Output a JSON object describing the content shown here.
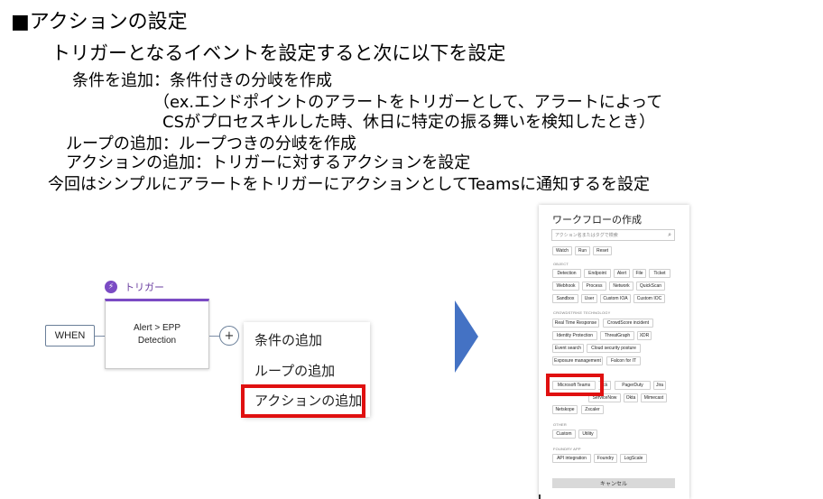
{
  "slide": {
    "title": "■アクションの設定",
    "line1": "トリガーとなるイベントを設定すると次に以下を設定",
    "line2": "条件を追加：条件付きの分岐を作成",
    "line3": "（ex.エンドポイントのアラートをトリガーとして、アラートによって",
    "line4": "CSがプロセスキルした時、休日に特定の振る舞いを検知したとき）",
    "line5": "ループの追加：ループつきの分岐を作成",
    "line6": "アクションの追加：トリガーに対するアクションを設定",
    "line7": "今回はシンプルにアラートをトリガーにアクションとしてTeamsに通知するを設定"
  },
  "workflow": {
    "trigger_label": "トリガー",
    "trigger_icon": "lightning-icon",
    "when_label": "WHEN",
    "node_line1": "Alert > EPP",
    "node_line2": "Detection",
    "plus_label": "+",
    "menu": [
      "条件の追加",
      "ループの追加",
      "アクションの追加"
    ]
  },
  "panel": {
    "title": "ワークフローの作成",
    "search_placeholder": "アクション名またはタグで検索",
    "top_chips": [
      "Watch",
      "Run",
      "Reset"
    ],
    "object_label": "OBJECT",
    "object_chips": [
      "Detection",
      "Endpoint",
      "Alert",
      "File",
      "Ticket",
      "Webhook",
      "Process",
      "Network",
      "QuickScan",
      "Sandbox",
      "User",
      "Custom IOA",
      "Custom IOC"
    ],
    "cs_label": "CROWDSTRIKE TECHNOLOGY",
    "cs_chips": [
      "Real Time Response",
      "CrowdScore incident",
      "Identity Protection",
      "ThreatGraph",
      "XDR",
      "Event search",
      "Cloud security posture",
      "Exposure management",
      "Falcon for IT"
    ],
    "third_chips": [
      "Microsoft Teams",
      "ack",
      "PagerDuty",
      "Jira",
      "ServiceNow",
      "Okta",
      "Mimecast",
      "Netskope",
      "Zscaler"
    ],
    "other_label": "OTHER",
    "other_chips": [
      "Custom",
      "Utility"
    ],
    "foundry_label": "FOUNDRY APP",
    "foundry_chips": [
      "API integration",
      "Foundry",
      "LogScale"
    ],
    "cancel_label": "キャンセル"
  },
  "colors": {
    "accent_purple": "#7b4bc4",
    "highlight_red": "#e01010",
    "arrow_blue": "#4472c4"
  }
}
